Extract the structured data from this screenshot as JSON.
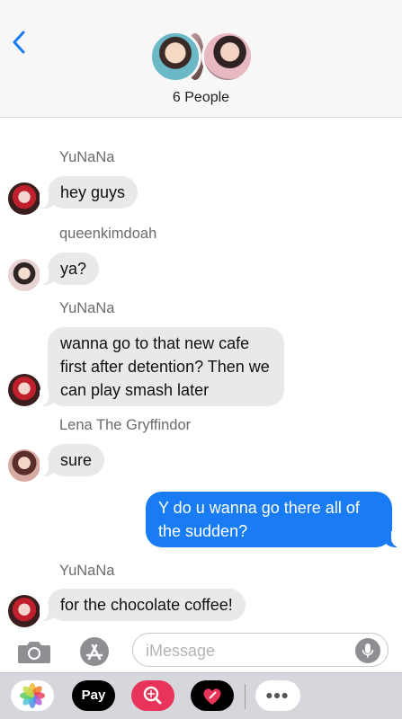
{
  "header": {
    "group_label": "6 People"
  },
  "messages": [
    {
      "sender": "YuNaNa",
      "text": "hey guys"
    },
    {
      "sender": "queenkimdoah",
      "text": "ya?"
    },
    {
      "sender": "YuNaNa",
      "text": "wanna go to that new cafe first after detention? Then we can play smash later"
    },
    {
      "sender": "Lena The Gryffindor",
      "text": "sure"
    },
    {
      "sender": "",
      "text": "Y do u wanna go there all of the sudden?"
    },
    {
      "sender": "YuNaNa",
      "text": "for the chocolate coffee!"
    }
  ],
  "input": {
    "placeholder": "iMessage"
  },
  "apps": {
    "pay_label": "Pay",
    "pay_symbol": "",
    "items": [
      "photos-icon",
      "apple-pay-icon",
      "image-search-icon",
      "heart-sticker-icon",
      "more-icon"
    ]
  },
  "colors": {
    "accent": "#1a7cf5",
    "incoming_bubble": "#e9e9eb",
    "outgoing_bubble": "#1a7cf5"
  }
}
